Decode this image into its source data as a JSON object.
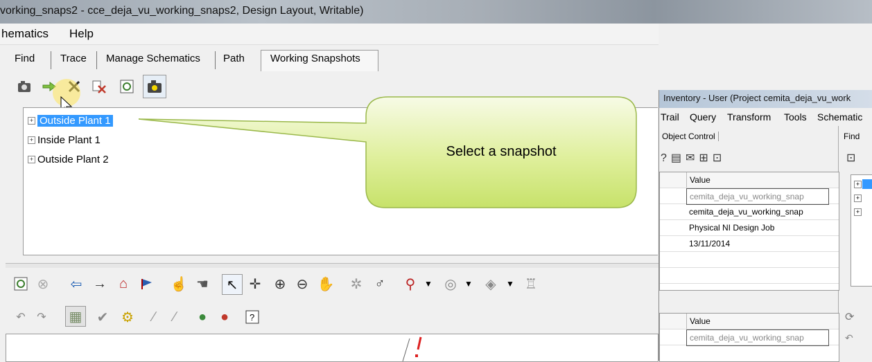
{
  "window": {
    "title": "vorking_snaps2 - cce_deja_vu_working_snaps2, Design Layout, Writable)"
  },
  "menu": {
    "items": [
      "hematics",
      "Help"
    ]
  },
  "tabs": [
    "Find",
    "Trace",
    "Manage Schematics",
    "Path",
    "Working Snapshots"
  ],
  "active_tab": "Working Snapshots",
  "snapshots_toolbar": {
    "icons": [
      "camera-icon",
      "arrow-right-icon",
      "delete-icon",
      "delete-all-icon",
      "refresh-icon",
      "snapshot-manager-icon"
    ]
  },
  "tree": {
    "nodes": [
      {
        "label": "Outside Plant 1",
        "selected": true
      },
      {
        "label": "Inside Plant 1",
        "selected": false
      },
      {
        "label": "Outside Plant 2",
        "selected": false
      }
    ]
  },
  "callout": {
    "text": "Select a snapshot"
  },
  "right_window": {
    "title": "Inventory - User (Project cemita_deja_vu_work",
    "menu": [
      "Trail",
      "Query",
      "Transform",
      "Tools",
      "Schematic"
    ],
    "object_control_tab": "Object Control",
    "find_tab": "Find",
    "grid1": {
      "header": "Value",
      "rows": [
        "cemita_deja_vu_working_snap",
        "cemita_deja_vu_working_snap",
        "Physical NI Design Job",
        "13/11/2014",
        "",
        ""
      ]
    },
    "grid2": {
      "header": "Value",
      "rows": [
        "cemita_deja_vu_working_snap"
      ]
    }
  },
  "colors": {
    "selection": "#3399ff",
    "callout_fill": "#d8ec8a",
    "callout_border": "#9ab84a"
  }
}
